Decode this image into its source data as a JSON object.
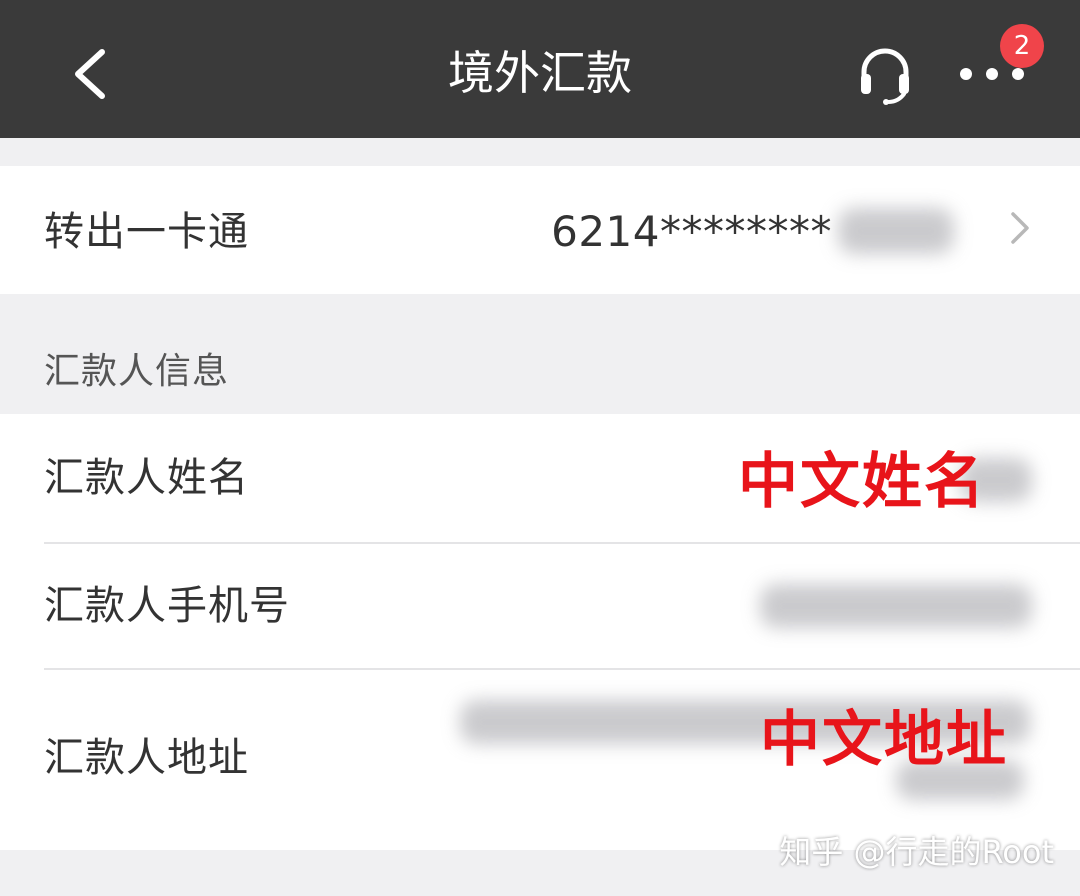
{
  "navbar": {
    "title": "境外汇款",
    "back_icon": "chevron-left-icon",
    "service_icon": "headset-icon",
    "more_icon": "more-dots-icon",
    "badge_count": "2",
    "badge_color": "#f0444a",
    "background": "#3a3a3a"
  },
  "card": {
    "label": "转出一卡通",
    "number_visible": "6214********"
  },
  "remitter": {
    "section_title": "汇款人信息",
    "name_label": "汇款人姓名",
    "phone_label": "汇款人手机号",
    "address_label": "汇款人地址"
  },
  "annotations": {
    "name": "中文姓名",
    "address": "中文地址",
    "color": "#e8141a"
  },
  "watermark": "知乎 @行走的Root"
}
